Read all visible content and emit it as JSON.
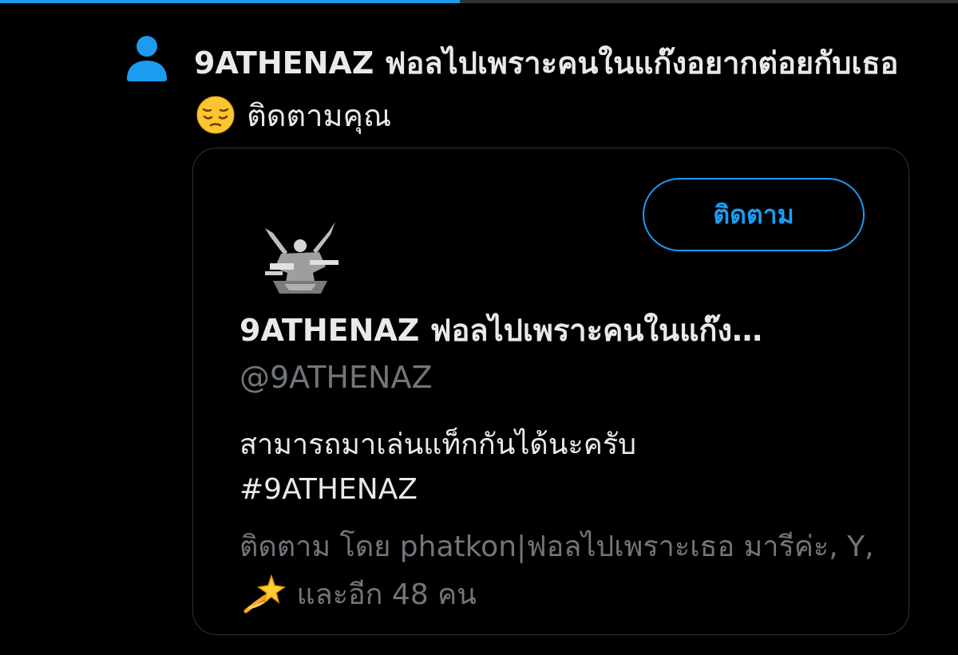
{
  "progress": {
    "fraction": 0.48,
    "fill_color": "#1d9bf0"
  },
  "notification": {
    "icon": "person-icon",
    "user_name": "9ATHENAZ ฟอลไปเพราะคนในแก๊งอยากต่อยกับเธอ",
    "emoji": "pensive-face-emoji",
    "action_text": "ติดตามคุณ"
  },
  "profile_card": {
    "follow_button_label": "ติดตาม",
    "display_name": "9ATHENAZ ฟอลไปเพราะคนในแก๊ง…",
    "handle": "@9ATHENAZ",
    "bio_line": "สามารถมาเล่นแท็กกันได้นะครับ",
    "bio_hashtag": "#9ATHENAZ",
    "followed_by_prefix": "ติดตาม โดย phatkon|ฟอลไปเพราะเธอ มารีค่ะ, Y,",
    "followed_by_emoji": "dizzy-emoji",
    "followed_by_suffix": "และอีก 48 คน"
  },
  "colors": {
    "accent": "#1d9bf0",
    "text_primary": "#e7e9ea",
    "text_secondary": "#71767b",
    "border": "#2f3336",
    "background": "#000000"
  }
}
